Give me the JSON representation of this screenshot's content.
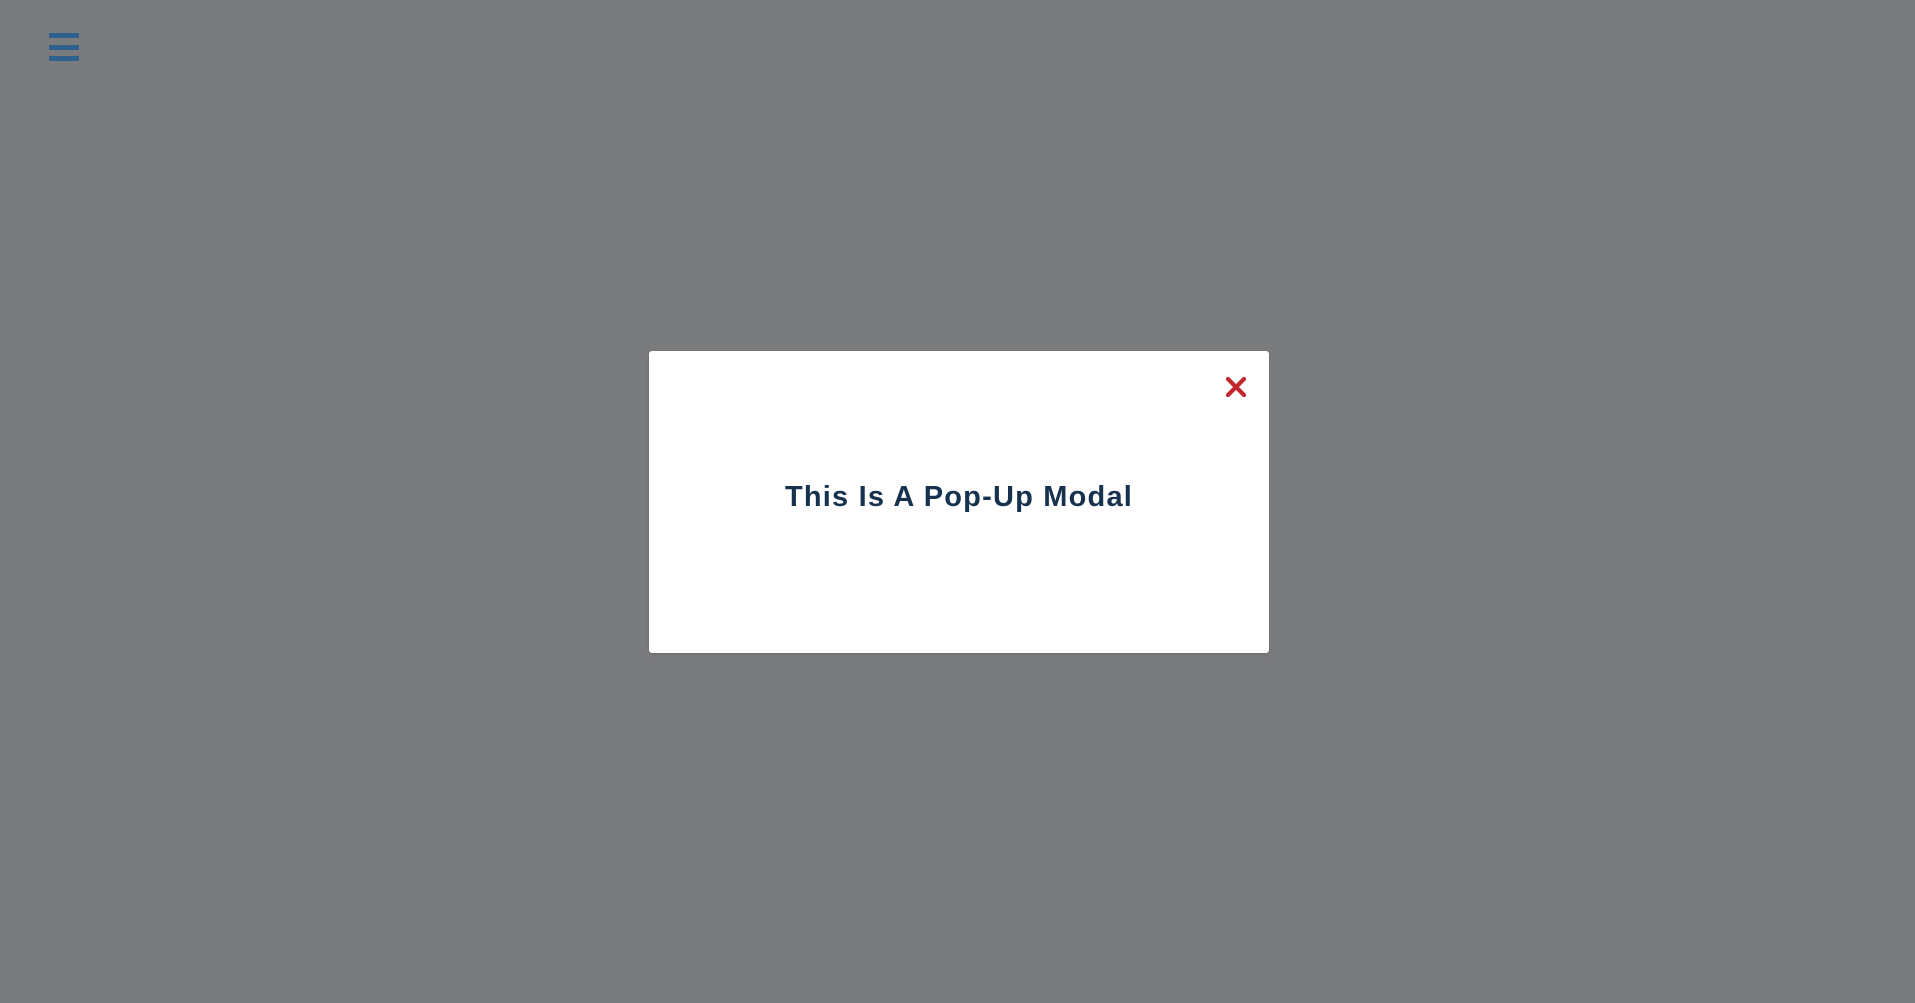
{
  "theme": {
    "overlay_color": "#7a7b7d",
    "menu_icon_color": "#2f5f8d",
    "modal_background": "#ffffff",
    "title_color": "#16324f",
    "close_icon_color": "#c1272d"
  },
  "header": {
    "menu_icon": "hamburger-menu-icon"
  },
  "modal": {
    "title": "This Is A Pop-Up Modal",
    "close_icon": "close-icon"
  }
}
